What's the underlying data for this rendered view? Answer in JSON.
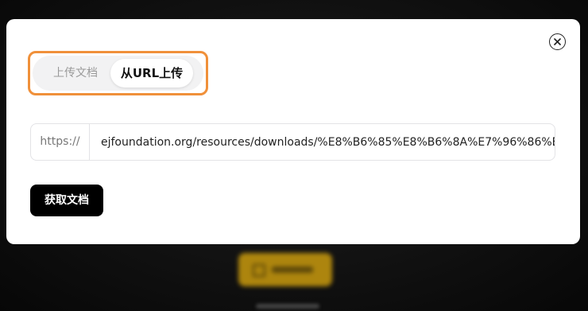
{
  "modal": {
    "tabs": [
      {
        "label": "上传文档",
        "active": false
      },
      {
        "label": "从URL上传",
        "active": true
      }
    ],
    "url": {
      "prefix": "https://",
      "value": "ejfoundation.org/resources/downloads/%E8%B6%85%E8%B6%8A%E7%96%86%E7%"
    },
    "fetch_button_label": "获取文档",
    "close_icon": "close-icon"
  },
  "colors": {
    "highlight": "#f0903a",
    "primary_button": "#000000",
    "background_button": "#c99a0e"
  }
}
